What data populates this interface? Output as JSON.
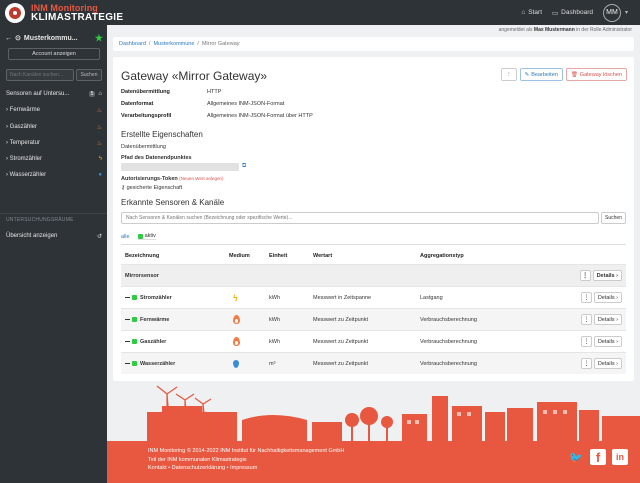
{
  "brand": {
    "line1": "INM Monitoring",
    "line2": "KLIMASTRATEGIE"
  },
  "topnav": {
    "start": "Start",
    "dashboard": "Dashboard",
    "avatar": "MM"
  },
  "sidebar": {
    "title": "Musterkommu...",
    "account": "Account anzeigen",
    "search_placeholder": "Nach Kanälen suchen...",
    "search_button": "Suchen",
    "sensors_label": "Sensoren auf Untersu...",
    "sensors_count": "5",
    "items": [
      {
        "label": "Fernwärme",
        "icon": "flame-icon"
      },
      {
        "label": "Gaszähler",
        "icon": "flame-icon"
      },
      {
        "label": "Temperatur",
        "icon": "flame-icon"
      },
      {
        "label": "Stromzähler",
        "icon": "bolt-icon"
      },
      {
        "label": "Wasserzähler",
        "icon": "drop-icon"
      }
    ],
    "section_label": "UNTERSUCHUNGSRÄUME",
    "overview": "Übersicht anzeigen"
  },
  "userline": {
    "prefix": "angemeldet als",
    "name": "Max Mustermann",
    "suffix": "in der Rolle Administrator"
  },
  "breadcrumb": {
    "dashboard": "Dashboard",
    "kommune": "Musterkommune",
    "current": "Mirror Gateway"
  },
  "gateway": {
    "title": "Gateway «Mirror Gateway»",
    "edit": "Bearbeiten",
    "delete": "Gateway löschen",
    "fields": [
      {
        "k": "Datenübermittlung",
        "v": "HTTP"
      },
      {
        "k": "Datenformat",
        "v": "Allgemeines INM-JSON-Format"
      },
      {
        "k": "Verarbeitungsprofil",
        "v": "Allgemeines INM-JSON-Format über HTTP"
      }
    ]
  },
  "properties": {
    "heading": "Erstellte Eigenschaften",
    "sub": "Datenübermittlung",
    "path_label": "Pfad des Datenendpunktes",
    "token_label": "Autorisierungs-Token",
    "token_new": "(Neuen Wert anlegen)",
    "secured": "gesicherte Eigenschaft"
  },
  "sensors": {
    "heading": "Erkannte Sensoren & Kanäle",
    "search_placeholder": "Nach Sensoren & Kanälen suchen (Bezeichnung oder spezifische Werte)...",
    "search_button": "Suchen",
    "tab_all": "alle",
    "tab_active": "aktiv",
    "headers": [
      "Bezeichnung",
      "Medium",
      "Einheit",
      "Wertart",
      "Aggregationstyp"
    ],
    "group": "Mirrorsensor",
    "details": "Details",
    "rows": [
      {
        "name": "Stromzähler",
        "icon": "bolt-icon",
        "unit": "kWh",
        "wertart": "Messwert in Zeitspanne",
        "agg": "Lastgang"
      },
      {
        "name": "Fernwärme",
        "icon": "flame-icon",
        "unit": "kWh",
        "wertart": "Messwert zu Zeitpunkt",
        "agg": "Verbrauchsberechnung"
      },
      {
        "name": "Gaszähler",
        "icon": "flame-icon",
        "unit": "kWh",
        "wertart": "Messwert zu Zeitpunkt",
        "agg": "Verbrauchsberechnung"
      },
      {
        "name": "Wasserzähler",
        "icon": "drop-icon",
        "unit": "m³",
        "wertart": "Messwert zu Zeitpunkt",
        "agg": "Verbrauchsberechnung"
      }
    ]
  },
  "footer": {
    "line1": "INM Monitoring © 2014-2022 INM Institut für Nachhaltigkeitsmanagement GmbH",
    "line2": "Teil der INM kommunalen Klimastrategie",
    "line3": "Kontakt • Datenschutzerklärung • Impressum"
  },
  "colors": {
    "accent": "#e8573f",
    "sidebar": "#2e3338",
    "link": "#2b7bbf",
    "active": "#2ecc40"
  }
}
